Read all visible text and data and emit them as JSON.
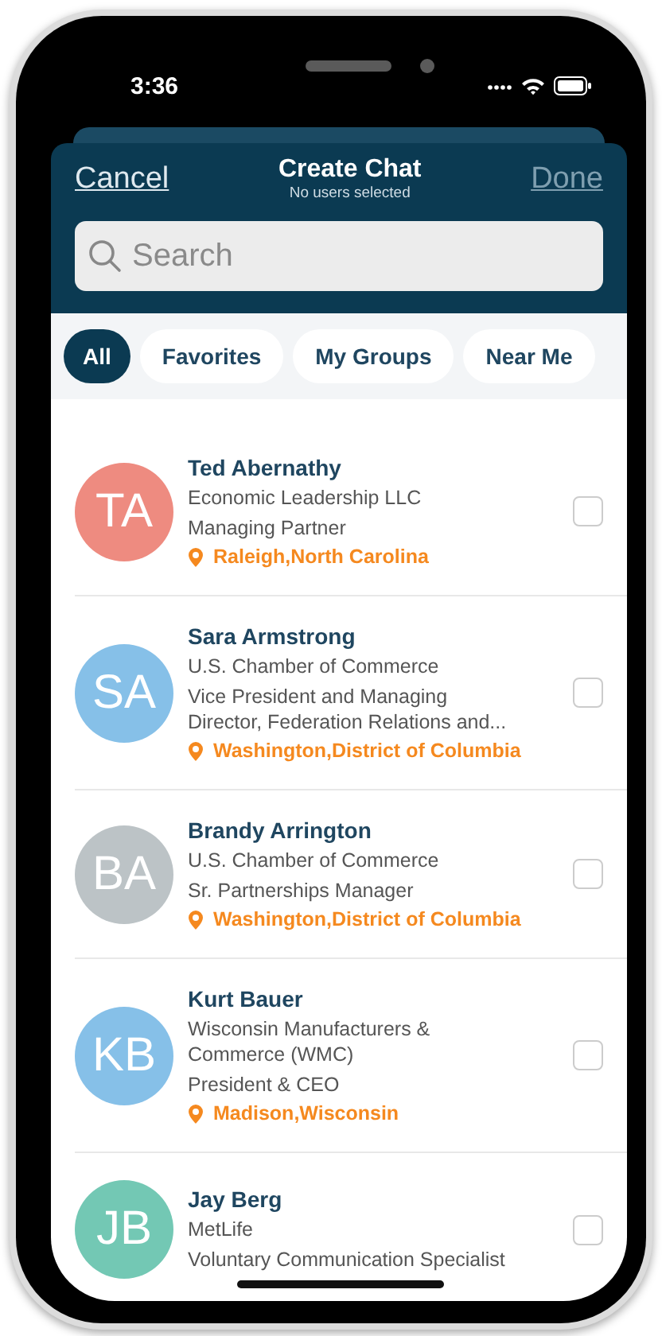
{
  "status_bar": {
    "time": "3:36"
  },
  "header": {
    "cancel": "Cancel",
    "title": "Create Chat",
    "subtitle": "No users selected",
    "done": {
      "label": "Done",
      "disabled": true
    }
  },
  "search": {
    "placeholder": "Search"
  },
  "filters": [
    {
      "label": "All",
      "selected": true
    },
    {
      "label": "Favorites",
      "selected": false
    },
    {
      "label": "My Groups",
      "selected": false
    },
    {
      "label": "Near Me",
      "selected": false
    }
  ],
  "contacts": [
    {
      "initials": "TA",
      "color": "#ee8b80",
      "name": "Ted Abernathy",
      "details": [
        "Economic Leadership LLC",
        "Managing Partner"
      ],
      "location": "Raleigh,North Carolina",
      "checked": false
    },
    {
      "initials": "SA",
      "color": "#86c0e8",
      "name": "Sara Armstrong",
      "details": [
        "U.S. Chamber of Commerce",
        "Vice President and Managing Director, Federation Relations and..."
      ],
      "location": "Washington,District of Columbia",
      "checked": false
    },
    {
      "initials": "BA",
      "color": "#bcc3c6",
      "name": "Brandy Arrington",
      "details": [
        "U.S. Chamber of Commerce",
        "Sr. Partnerships Manager"
      ],
      "location": "Washington,District of Columbia",
      "checked": false
    },
    {
      "initials": "KB",
      "color": "#86c0e8",
      "name": "Kurt Bauer",
      "details": [
        "Wisconsin Manufacturers & Commerce (WMC)",
        "President & CEO"
      ],
      "location": "Madison,Wisconsin",
      "checked": false
    },
    {
      "initials": "JB",
      "color": "#73c8b4",
      "name": "Jay Berg",
      "details": [
        "MetLife",
        "Voluntary Communication Specialist"
      ],
      "checked": false
    }
  ]
}
